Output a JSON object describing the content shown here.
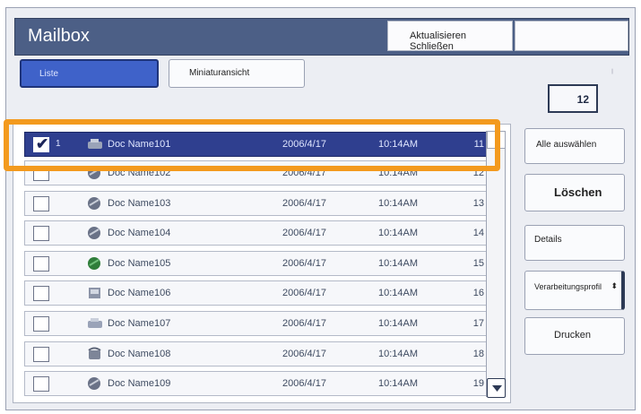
{
  "header": {
    "title": "Mailbox",
    "refresh_close_label": "Aktualisieren Schließen",
    "right_blank_label": ""
  },
  "tabs": {
    "list_label": "Liste",
    "thumbnail_label": "Miniaturansicht"
  },
  "count": "12",
  "rows": [
    {
      "num": "1",
      "name": "Doc Name101",
      "date": "2006/4/17",
      "time": "10:14AM",
      "index": "11",
      "checked": true,
      "icon": "scanner-doc-icon"
    },
    {
      "num": "",
      "name": "Doc Name102",
      "date": "2006/4/17",
      "time": "10:14AM",
      "index": "12",
      "checked": false,
      "icon": "globe-doc-icon"
    },
    {
      "num": "",
      "name": "Doc Name103",
      "date": "2006/4/17",
      "time": "10:14AM",
      "index": "13",
      "checked": false,
      "icon": "globe-doc-icon"
    },
    {
      "num": "",
      "name": "Doc Name104",
      "date": "2006/4/17",
      "time": "10:14AM",
      "index": "14",
      "checked": false,
      "icon": "globe-doc-icon"
    },
    {
      "num": "",
      "name": "Doc Name105",
      "date": "2006/4/17",
      "time": "10:14AM",
      "index": "15",
      "checked": false,
      "icon": "green-globe-icon"
    },
    {
      "num": "",
      "name": "Doc Name106",
      "date": "2006/4/17",
      "time": "10:14AM",
      "index": "16",
      "checked": false,
      "icon": "box-doc-icon"
    },
    {
      "num": "",
      "name": "Doc Name107",
      "date": "2006/4/17",
      "time": "10:14AM",
      "index": "17",
      "checked": false,
      "icon": "scanner-doc-icon"
    },
    {
      "num": "",
      "name": "Doc Name108",
      "date": "2006/4/17",
      "time": "10:14AM",
      "index": "18",
      "checked": false,
      "icon": "phone-doc-icon"
    },
    {
      "num": "",
      "name": "Doc Name109",
      "date": "2006/4/17",
      "time": "10:14AM",
      "index": "19",
      "checked": false,
      "icon": "globe-doc-icon"
    }
  ],
  "side_buttons": {
    "select_all": "Alle auswählen",
    "delete": "Löschen",
    "details": "Details",
    "processing_profile": "Verarbeitungsprofil",
    "print": "Drucken"
  },
  "colors": {
    "title_bar": "#4c5f86",
    "selected_row": "#2f3f8f",
    "active_tab": "#3f62c9",
    "highlight": "#f39a1e"
  }
}
